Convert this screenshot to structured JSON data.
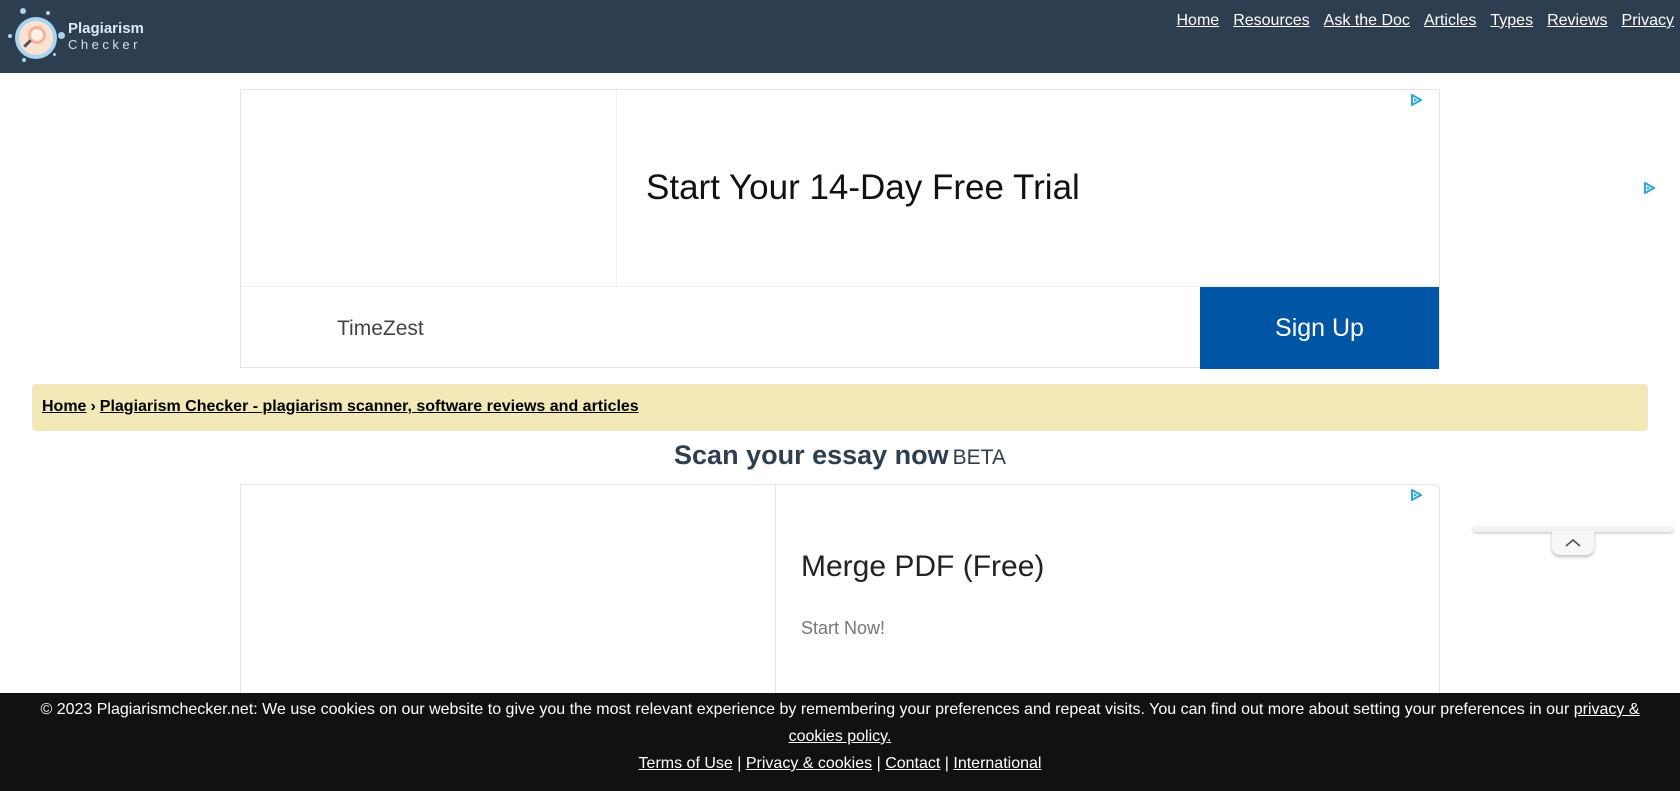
{
  "header": {
    "logo": {
      "title": "Plagiarism",
      "subtitle": "Checker"
    },
    "nav": [
      {
        "label": "Home"
      },
      {
        "label": "Resources"
      },
      {
        "label": "Ask the Doc"
      },
      {
        "label": "Articles"
      },
      {
        "label": "Types"
      },
      {
        "label": "Reviews"
      },
      {
        "label": "Privacy"
      }
    ]
  },
  "ad_top": {
    "headline": "Start Your 14-Day Free Trial",
    "advertiser": "TimeZest",
    "cta_label": "Sign Up",
    "cta_color": "#0055a5",
    "icon": "adchoices-icon"
  },
  "ad_right": {
    "icon": "adchoices-icon"
  },
  "breadcrumb": {
    "items": [
      {
        "label": "Home"
      },
      {
        "label": "Plagiarism Checker - plagiarism scanner, software reviews and articles"
      }
    ],
    "separator": "›"
  },
  "scan": {
    "title": "Scan your essay now",
    "badge": "BETA"
  },
  "ad_middle": {
    "headline": "Merge PDF (Free)",
    "subtext": "Start Now!",
    "icon": "adchoices-icon"
  },
  "collapse": {
    "icon": "chevron-up-icon"
  },
  "cookie_notice": {
    "message": "© 2023 Plagiarismchecker.net: We use cookies on our website to give you the most relevant experience by remembering your preferences and repeat visits. You can find out more about setting your preferences in our ",
    "policy_link": "privacy & cookies policy.",
    "links": [
      {
        "label": "Terms of Use"
      },
      {
        "label": "Privacy & cookies"
      },
      {
        "label": "Contact"
      },
      {
        "label": "International"
      }
    ],
    "link_separator": "|"
  },
  "colors": {
    "header_bg": "#2d3e50",
    "breadcrumb_bg": "#f3e8b8",
    "footer_bg": "#111111",
    "heading_color": "#2d3e50",
    "adchoices_color": "#29a8d6"
  }
}
